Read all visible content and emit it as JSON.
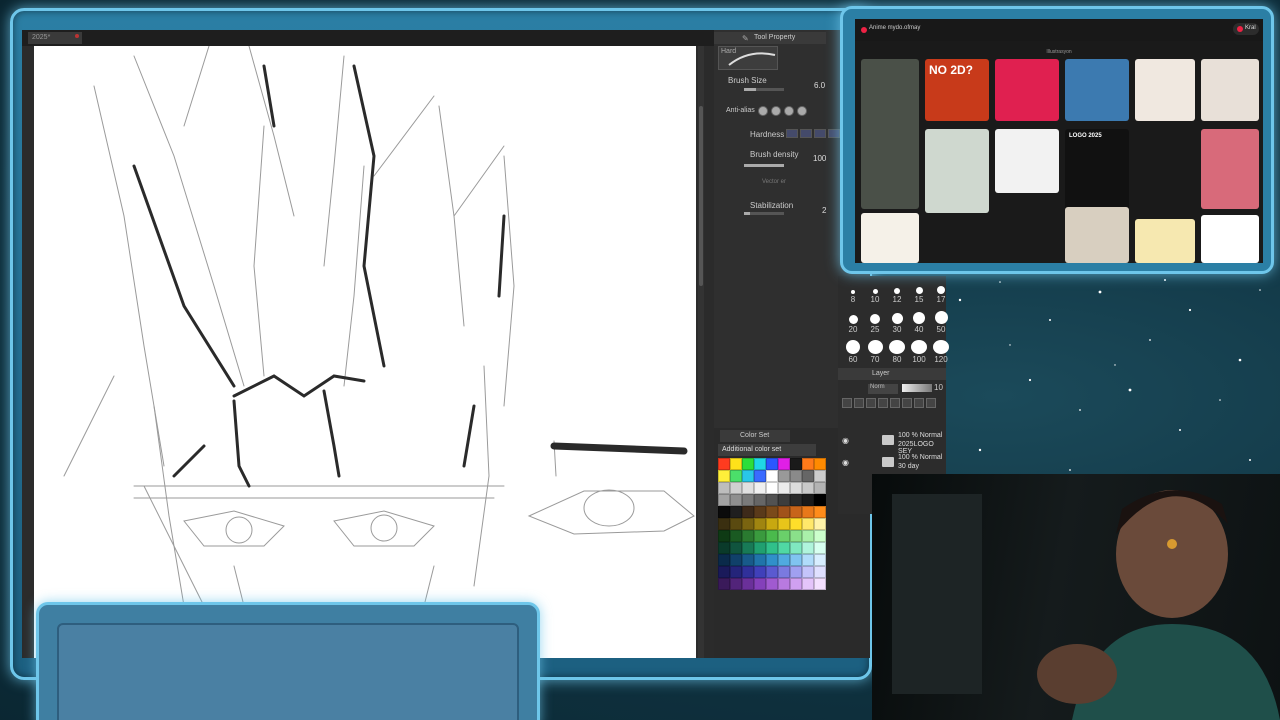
{
  "app": {
    "doc_tab": "2025*",
    "panel_title": "Tool Property",
    "brush_preset": "Hard",
    "brush_size_label": "Brush Size",
    "brush_size_value": "6.0",
    "antialias_label": "Anti-alias",
    "hardness_label": "Hardness",
    "brush_density_label": "Brush density",
    "brush_density_value": "100",
    "vector_label": "Vector er",
    "stabilization_label": "Stabilization",
    "stabilization_value": "2",
    "color_set_label": "Color Set",
    "color_set_dropdown": "Additional color set",
    "swatches": [
      "#ff3b1f",
      "#ffe21a",
      "#2dde3a",
      "#1fd7e6",
      "#2a57ff",
      "#e01fe6",
      "#1a1a1a",
      "#ff7a1a",
      "#ff8a00",
      "#ffef3a",
      "#4bdf6a",
      "#29c6e8",
      "#3a6bff",
      "#ffffff",
      "#999999",
      "#8a8a8a",
      "#666666",
      "#cccccc",
      "#bdbdbd",
      "#d0d0d0",
      "#e0e0e0",
      "#f0f0f0",
      "#ffffff",
      "#ececec",
      "#dcdcdc",
      "#c9c9c9",
      "#b3b3b3",
      "#a3a3a3",
      "#8f8f8f",
      "#7a7a7a",
      "#666666",
      "#525252",
      "#3d3d3d",
      "#2a2a2a",
      "#1a1a1a",
      "#000000",
      "#0b0b0b",
      "#1f1f1f",
      "#3d2a1a",
      "#5a3a1a",
      "#7a4a1a",
      "#a1521a",
      "#c8641a",
      "#e8781a",
      "#ff8c1a",
      "#3a2f10",
      "#5a4a10",
      "#7a6410",
      "#a08510",
      "#c8a810",
      "#e8c51a",
      "#ffde2a",
      "#ffe86a",
      "#fff3a8",
      "#0e3a14",
      "#1a5a22",
      "#2a7a30",
      "#3a9a3e",
      "#4aba4c",
      "#6ad06a",
      "#8ae08a",
      "#aaf0aa",
      "#ccffcc",
      "#0a3a2a",
      "#10543e",
      "#187a56",
      "#20a070",
      "#30c08a",
      "#50d8a4",
      "#80e8c0",
      "#b0f4dc",
      "#d8fff0",
      "#0a2a4a",
      "#10406a",
      "#185a8a",
      "#2074aa",
      "#3090ca",
      "#50aae0",
      "#80c4f0",
      "#b0dcfa",
      "#d8eeff",
      "#1a1a5a",
      "#24247a",
      "#30309a",
      "#4040ba",
      "#5a5ad0",
      "#7a7ae0",
      "#a0a0f0",
      "#c4c4fa",
      "#e0e0ff",
      "#3a1a5a",
      "#52247a",
      "#6a309a",
      "#8440ba",
      "#a05ad0",
      "#b87ae0",
      "#d0a0f0",
      "#e4c4fa",
      "#f4e0ff"
    ]
  },
  "brush_sizes": [
    "8",
    "10",
    "12",
    "15",
    "17",
    "20",
    "25",
    "30",
    "40",
    "50",
    "60",
    "70",
    "80",
    "100",
    "120"
  ],
  "layers": {
    "header": "Layer",
    "blend_mode": "Norm",
    "opacity": "10",
    "items": [
      {
        "line1": "100 % Normal",
        "line2": "2025LOGO SEY"
      },
      {
        "line1": "100 % Normal",
        "line2": "30 day"
      }
    ]
  },
  "browser": {
    "site_title": "Anime mydo.ofmay",
    "subtitle": "Illustrasyon",
    "user_button": "Kral",
    "thumbs": [
      {
        "label": "NO 2D?",
        "color": "#c83a1a"
      },
      {
        "label": "",
        "color": "#e02050"
      },
      {
        "label": "",
        "color": "#3c7ab0"
      },
      {
        "label": "",
        "color": "#f0e8e0"
      },
      {
        "label": "",
        "color": "#e8e0d8"
      },
      {
        "label": "",
        "color": "#cfd8cf"
      },
      {
        "label": "",
        "color": "#f2f2f2"
      },
      {
        "label": "LOGO 2025",
        "color": "#111111"
      },
      {
        "label": "",
        "color": "#1a1a1a"
      },
      {
        "label": "",
        "color": "#d86a7a"
      },
      {
        "label": "",
        "color": "#d8cfc0"
      },
      {
        "label": "",
        "color": "#f6e8b0"
      },
      {
        "label": "",
        "color": "#ffffff"
      },
      {
        "label": "",
        "color": "#f0c040"
      },
      {
        "label": "",
        "color": "#e8e4f0"
      },
      {
        "label": "",
        "color": "#dfe8ef"
      },
      {
        "label": "",
        "color": "#6a5040"
      }
    ]
  }
}
